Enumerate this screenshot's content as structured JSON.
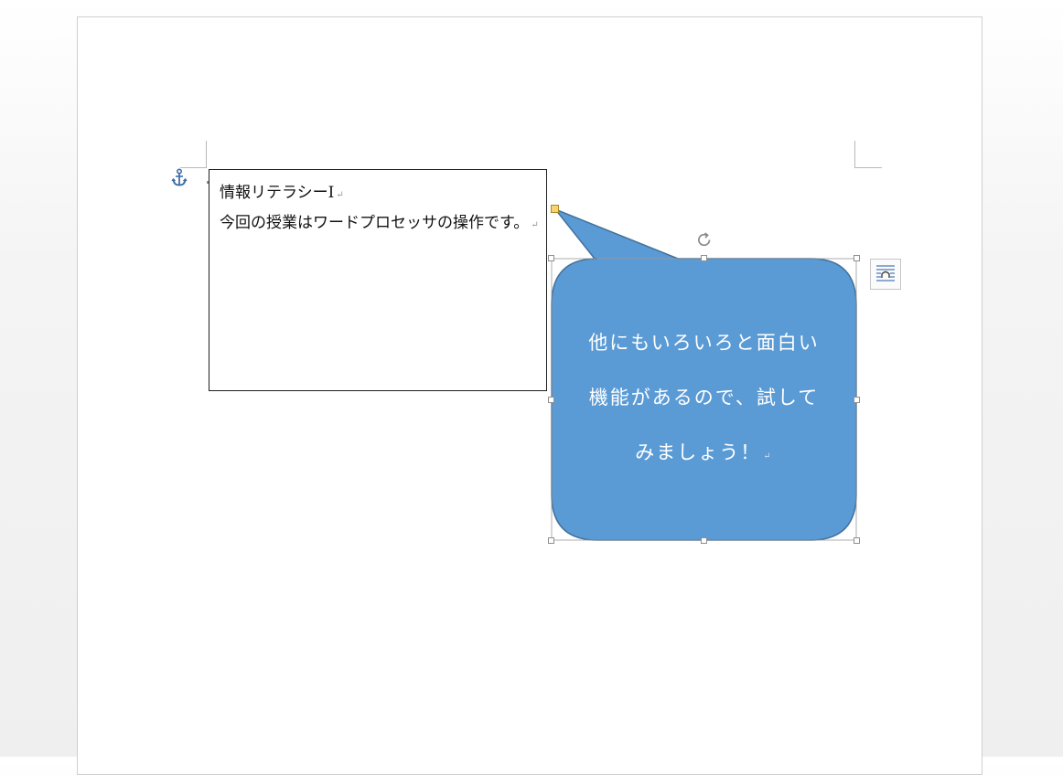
{
  "document": {
    "textbox": {
      "line1": "情報リテラシーⅠ",
      "line2": "今回の授業はワードプロセッサの操作です。",
      "paragraph_mark": "↵"
    },
    "callout": {
      "line1": "他にもいろいろと面白い",
      "line2": "機能があるので、試して",
      "line3": "みましょう！",
      "paragraph_mark": "↵",
      "fill_color": "#5b9bd5",
      "stroke_color": "#41719c"
    }
  },
  "icons": {
    "anchor": "anchor-icon",
    "rotate": "rotate-handle-icon",
    "layout_options": "layout-options-icon"
  }
}
